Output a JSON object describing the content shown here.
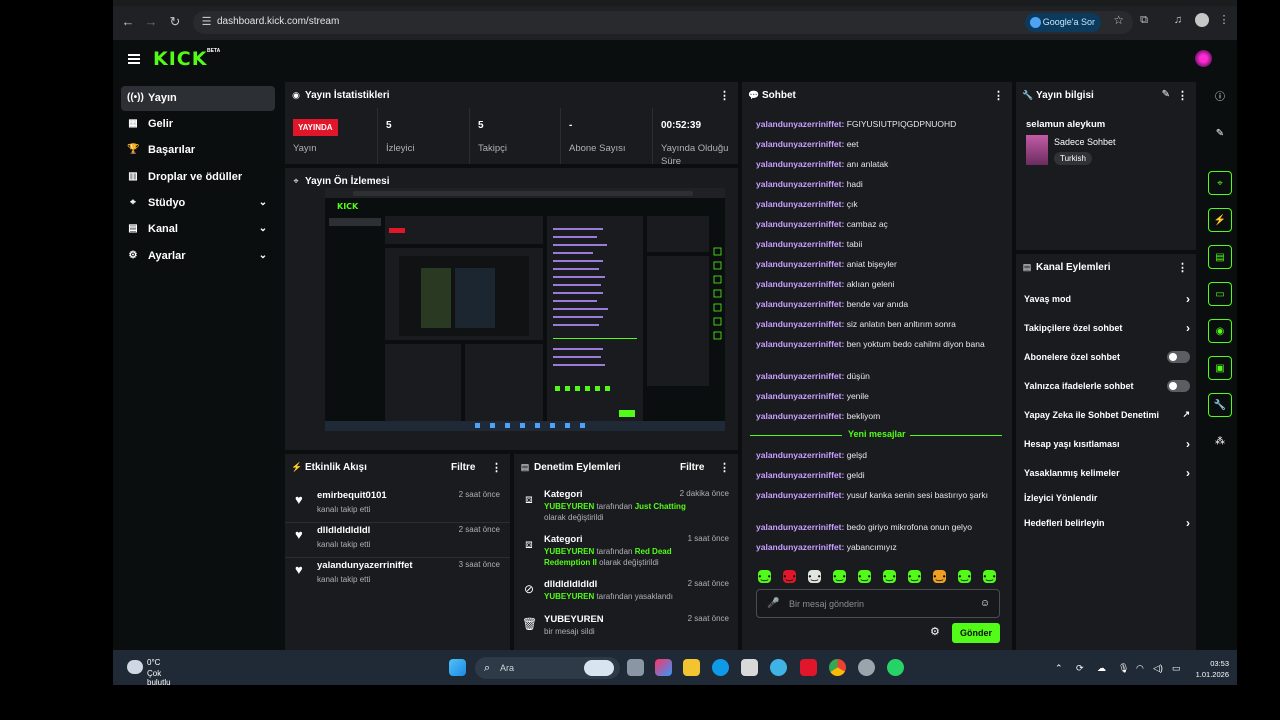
{
  "browser": {
    "url": "dashboard.kick.com/stream",
    "google_button": "Google'a Sor"
  },
  "header": {
    "logo": "KICK",
    "beta": "BETA"
  },
  "sidebar": {
    "items": [
      {
        "label": "Yayın",
        "icon": "broadcast-icon"
      },
      {
        "label": "Gelir",
        "icon": "revenue-icon"
      },
      {
        "label": "Başarılar",
        "icon": "trophy-icon"
      },
      {
        "label": "Droplar ve ödüller",
        "icon": "gift-icon"
      },
      {
        "label": "Stüdyo",
        "icon": "studio-icon"
      },
      {
        "label": "Kanal",
        "icon": "channel-icon"
      },
      {
        "label": "Ayarlar",
        "icon": "settings-icon"
      }
    ]
  },
  "stats": {
    "title": "Yayın İstatistikleri",
    "live_badge": "YAYINDA",
    "live_label": "Yayın",
    "viewers_value": "5",
    "viewers_label": "İzleyici",
    "followers_value": "5",
    "followers_label": "Takipçi",
    "subs_value": "-",
    "subs_label": "Abone Sayısı",
    "uptime_value": "00:52:39",
    "uptime_label": "Yayında Olduğu Süre"
  },
  "preview": {
    "title": "Yayın Ön İzlemesi"
  },
  "activity": {
    "title": "Etkinlik Akışı",
    "filter": "Filtre",
    "items": [
      {
        "name": "emirbequit0101",
        "sub": "kanalı takip etti",
        "time": "2 saat önce"
      },
      {
        "name": "dlldldldldldl",
        "sub": "kanalı takip etti",
        "time": "2 saat önce"
      },
      {
        "name": "yalandunyazerriniffet",
        "sub": "kanalı takip etti",
        "time": "3 saat önce"
      }
    ]
  },
  "moderation": {
    "title": "Denetim Eylemleri",
    "filter": "Filtre",
    "items": [
      {
        "title": "Kategori",
        "time": "2 dakika önce",
        "user": "YUBEYUREN",
        "mid": " tarafından ",
        "target": "Just Chatting",
        "tail": " olarak değiştirildi"
      },
      {
        "title": "Kategori",
        "time": "1 saat önce",
        "user": "YUBEYUREN",
        "mid": " tarafından ",
        "target": "Red Dead Redemption II",
        "tail": " olarak değiştirildi"
      },
      {
        "title": "dlldldldldldl",
        "time": "2 saat önce",
        "user": "YUBEYUREN",
        "mid": " tarafından yasaklandı",
        "target": "",
        "tail": ""
      },
      {
        "title": "YUBEYUREN",
        "time": "2 saat önce",
        "plain": "bir mesajı sildi"
      }
    ]
  },
  "chat": {
    "title": "Sohbet",
    "new_messages": "Yeni mesajlar",
    "username": "yalandunyazerriniffet:",
    "messages": [
      "FGIYUSIUTPIQGDPNUOHD",
      "eet",
      "anı anlatak",
      "hadi",
      "çık",
      "cambaz aç",
      "tabii",
      "aniat bişeyler",
      "aklıan geleni",
      "bende var anıda",
      "siz anlatın ben anltırım sonra",
      "ben yoktum bedo cahilmi diyon bana",
      "düşün",
      "yenile",
      "bekliyom"
    ],
    "new_list": [
      "gelşd",
      "geldi",
      "yusuf kanka senin sesi bastırıyo şarkı",
      "bedo giriyo mikrofona onun gelyo",
      "yabancımıyız"
    ],
    "placeholder": "Bir mesaj gönderin",
    "send": "Gönder"
  },
  "stream_info": {
    "title": "Yayın bilgisi",
    "stream_title": "selamun aleykum",
    "category": "Sadece Sohbet",
    "language": "Turkish"
  },
  "channel_actions": {
    "title": "Kanal Eylemleri",
    "rows": [
      {
        "label": "Yavaş mod",
        "kind": "chevron"
      },
      {
        "label": "Takipçilere özel sohbet",
        "kind": "chevron"
      },
      {
        "label": "Abonelere özel sohbet",
        "kind": "toggle"
      },
      {
        "label": "Yalnızca ifadelerle sohbet",
        "kind": "toggle"
      },
      {
        "label": "Yapay Zeka ile Sohbet Denetimi",
        "kind": "external"
      },
      {
        "label": "Hesap yaşı kısıtlaması",
        "kind": "chevron"
      },
      {
        "label": "Yasaklanmış kelimeler",
        "kind": "chevron"
      },
      {
        "label": "İzleyici Yönlendir",
        "kind": "none"
      },
      {
        "label": "Hedefleri belirleyin",
        "kind": "chevron"
      }
    ]
  },
  "taskbar": {
    "temp": "0°C",
    "weather": "Çok bulutlu",
    "search": "Ara",
    "time": "03:53",
    "date": "1.01.2026"
  },
  "colors": {
    "accent": "#53fc18",
    "live": "#e2162a",
    "username": "#c9a0ff",
    "panel": "#191b1f"
  }
}
